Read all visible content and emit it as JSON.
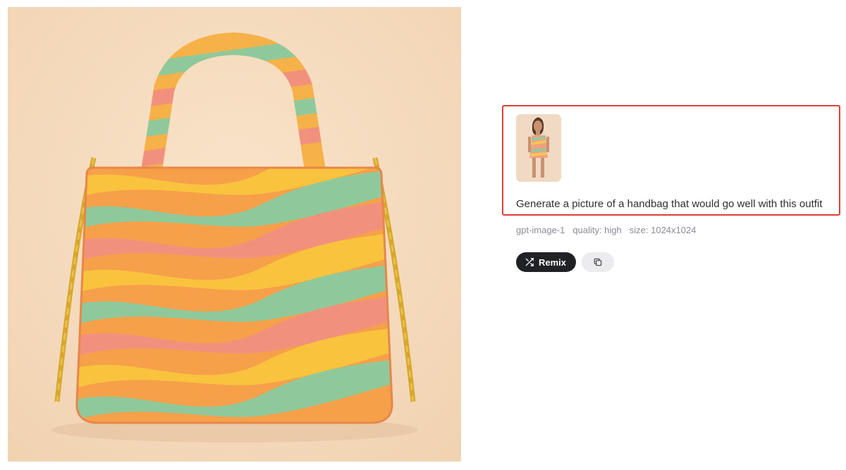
{
  "prompt": {
    "text": "Generate a picture of a handbag that would go well with this outfit"
  },
  "meta": {
    "model": "gpt-image-1",
    "quality": "quality: high",
    "size": "size: 1024x1024"
  },
  "actions": {
    "remix_label": "Remix",
    "remix_icon": "shuffle-icon",
    "copy_icon": "copy-icon"
  },
  "colors": {
    "highlight": "#dd3f35",
    "remix_bg": "#1f2125",
    "copy_bg": "#ececef",
    "meta_text": "#8a8d94"
  }
}
